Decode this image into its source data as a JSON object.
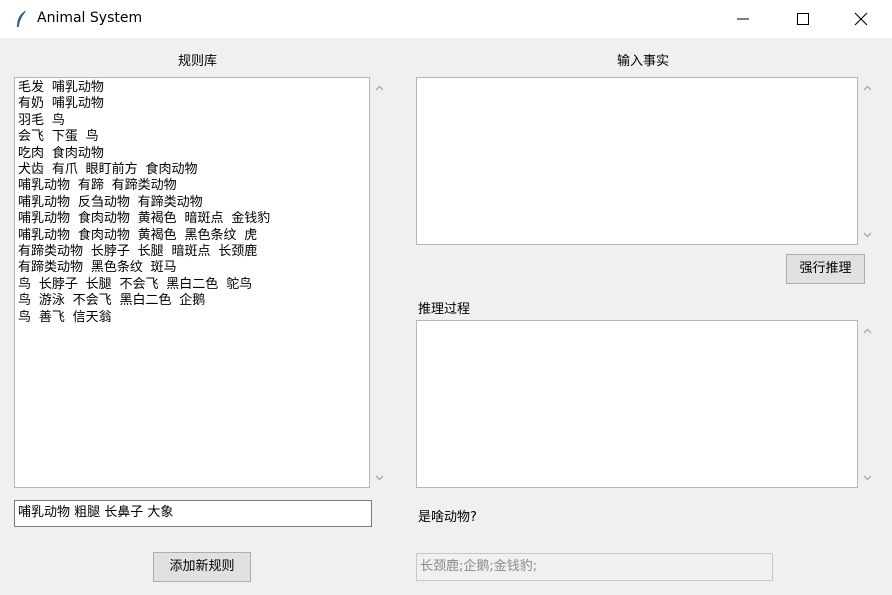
{
  "window": {
    "title": "Animal System",
    "icon": "feather-icon",
    "controls": [
      "minimize-icon",
      "maximize-icon",
      "close-icon"
    ]
  },
  "rules_panel": {
    "heading": "规则库",
    "rules_text": "毛发 哺乳动物\n有奶 哺乳动物\n羽毛 鸟\n会飞 下蛋 鸟\n吃肉 食肉动物\n犬齿 有爪 眼盯前方 食肉动物\n哺乳动物 有蹄 有蹄类动物\n哺乳动物 反刍动物 有蹄类动物\n哺乳动物 食肉动物 黄褐色 暗斑点 金钱豹\n哺乳动物 食肉动物 黄褐色 黑色条纹 虎\n有蹄类动物 长脖子 长腿 暗斑点 长颈鹿\n有蹄类动物 黑色条纹 斑马\n鸟 长脖子 长腿 不会飞 黑白二色 鸵鸟\n鸟 游泳 不会飞 黑白二色 企鹅\n鸟 善飞 信天翁",
    "new_rule_value": "哺乳动物 粗腿 长鼻子 大象",
    "add_button_label": "添加新规则"
  },
  "facts_panel": {
    "heading": "输入事实",
    "facts_value": "",
    "infer_button_label": "强行推理"
  },
  "process_panel": {
    "heading": "推理过程",
    "process_value": ""
  },
  "result_panel": {
    "question": "是啥动物?",
    "result_value": "长颈鹿;企鹅;金钱豹;"
  }
}
